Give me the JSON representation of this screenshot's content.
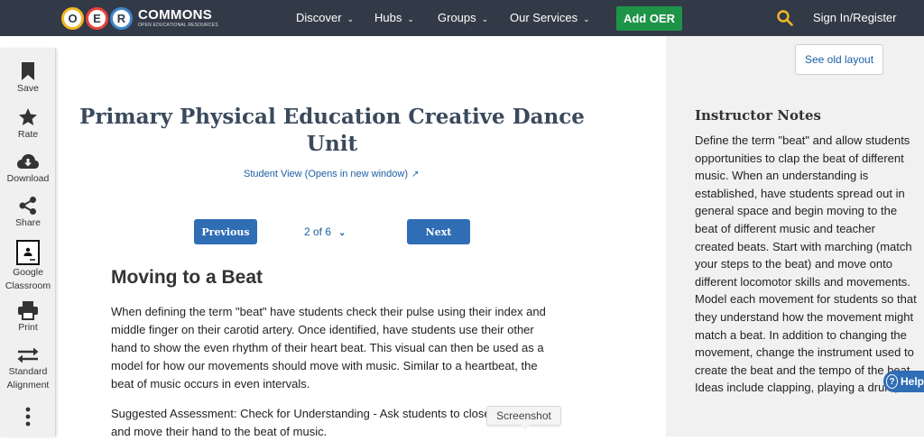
{
  "colors": {
    "nav_bg": "#333a47",
    "accent": "#2f6db5",
    "add_green": "#1e9448",
    "link": "#1b5fa3"
  },
  "logo": {
    "letters": [
      {
        "char": "O",
        "ring": "#f2b824"
      },
      {
        "char": "E",
        "ring": "#e8413c"
      },
      {
        "char": "R",
        "ring": "#3f86c9"
      }
    ],
    "main": "COMMONS",
    "sub": "OPEN EDUCATIONAL RESOURCES"
  },
  "nav": {
    "items": [
      {
        "label": "Discover",
        "icon": "chevron-down-icon"
      },
      {
        "label": "Hubs",
        "icon": "chevron-down-icon"
      },
      {
        "label": "Groups",
        "icon": "chevron-down-icon"
      },
      {
        "label": "Our Services",
        "icon": "chevron-down-icon"
      }
    ],
    "add_button": "Add OER",
    "search_icon": "search-icon",
    "signin": "Sign In/Register"
  },
  "toolbar": {
    "items": [
      {
        "label": "Save",
        "icon": "bookmark-icon"
      },
      {
        "label": "Rate",
        "icon": "star-icon"
      },
      {
        "label": "Download",
        "icon": "cloud-download-icon"
      },
      {
        "label": "Share",
        "icon": "share-icon"
      },
      {
        "label": "Google\nClassroom",
        "icon": "google-classroom-icon"
      },
      {
        "label": "Print",
        "icon": "printer-icon"
      },
      {
        "label": "Standard\nAlignment",
        "icon": "arrows-icon"
      },
      {
        "label": "",
        "icon": "more-vertical-icon"
      }
    ]
  },
  "main": {
    "title": "Primary Physical Education Creative Dance Unit",
    "student_view": "Student View (Opens in new window)",
    "prev_label": "Previous",
    "next_label": "Next",
    "page_indicator": "2 of 6",
    "section_title": "Moving to a Beat",
    "paragraphs": [
      "When defining the term \"beat\" have students check their pulse using their index and middle finger on their carotid artery. Once identified, have students use their other hand to show the even rhythm of their heart beat. This visual can then be used as a model for how our movements should move with music. Similar to a heartbeat, the beat of music occurs in even intervals.",
      "Suggested Assessment: Check for Understanding - Ask students to close their eyes and move their hand to the beat of music."
    ]
  },
  "right_panel": {
    "old_layout": "See old layout",
    "notes_title": "Instructor Notes",
    "notes_body": "Define the term \"beat\" and allow students opportunities to clap the beat of different music. When an understanding is established, have students spread out in general space and begin moving to the beat of different music and teacher created beats. Start with marching (match your steps to the beat) and move onto different locomotor skills and movements. Model each movement for students so that they understand how the movement might match a beat. In addition to changing the movement, change the instrument used to create the beat and the tempo of the beat. Ideas include clapping, playing a drum,"
  },
  "help": {
    "label": "Help"
  },
  "tooltip": {
    "label": "Screenshot"
  }
}
